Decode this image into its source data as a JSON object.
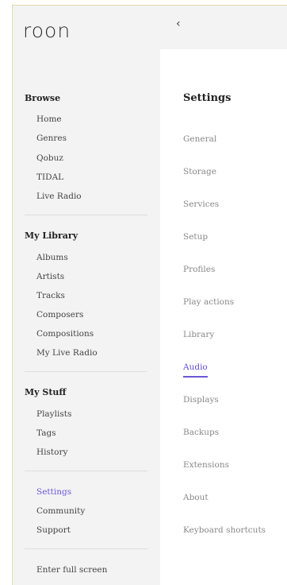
{
  "app": {
    "logo": "roon"
  },
  "sidebar": {
    "browse": {
      "title": "Browse",
      "items": [
        "Home",
        "Genres",
        "Qobuz",
        "TIDAL",
        "Live Radio"
      ]
    },
    "library": {
      "title": "My Library",
      "items": [
        "Albums",
        "Artists",
        "Tracks",
        "Composers",
        "Compositions",
        "My Live Radio"
      ]
    },
    "stuff": {
      "title": "My Stuff",
      "items": [
        "Playlists",
        "Tags",
        "History"
      ]
    },
    "bottom": {
      "items": [
        "Settings",
        "Community",
        "Support"
      ],
      "active": "Settings"
    },
    "fullscreen": "Enter full screen"
  },
  "topbar": {
    "back_icon": "‹"
  },
  "settings": {
    "title": "Settings",
    "items": [
      "General",
      "Storage",
      "Services",
      "Setup",
      "Profiles",
      "Play actions",
      "Library",
      "Audio",
      "Displays",
      "Backups",
      "Extensions",
      "About",
      "Keyboard shortcuts"
    ],
    "active": "Audio"
  },
  "colors": {
    "accent": "#6b58d8",
    "sidebar_bg": "#f3f3f3"
  }
}
